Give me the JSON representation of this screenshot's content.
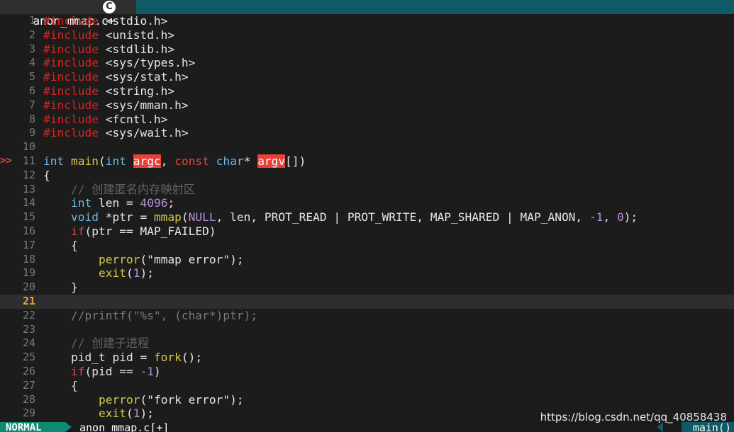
{
  "tabline": {
    "tab_title": "anon_mmap.c+",
    "lang_icon": "C"
  },
  "editor": {
    "sign_marker": ">>",
    "current_line": 21,
    "lines": [
      {
        "n": "1",
        "segs": [
          [
            "inc",
            "#include"
          ],
          [
            "txt",
            " <stdio.h>"
          ]
        ]
      },
      {
        "n": "2",
        "segs": [
          [
            "inc",
            "#include"
          ],
          [
            "txt",
            " <unistd.h>"
          ]
        ]
      },
      {
        "n": "3",
        "segs": [
          [
            "inc",
            "#include"
          ],
          [
            "txt",
            " <stdlib.h>"
          ]
        ]
      },
      {
        "n": "4",
        "segs": [
          [
            "inc",
            "#include"
          ],
          [
            "txt",
            " <sys/types.h>"
          ]
        ]
      },
      {
        "n": "5",
        "segs": [
          [
            "inc",
            "#include"
          ],
          [
            "txt",
            " <sys/stat.h>"
          ]
        ]
      },
      {
        "n": "6",
        "segs": [
          [
            "inc",
            "#include"
          ],
          [
            "txt",
            " <string.h>"
          ]
        ]
      },
      {
        "n": "7",
        "segs": [
          [
            "inc",
            "#include"
          ],
          [
            "txt",
            " <sys/mman.h>"
          ]
        ]
      },
      {
        "n": "8",
        "segs": [
          [
            "inc",
            "#include"
          ],
          [
            "txt",
            " <fcntl.h>"
          ]
        ]
      },
      {
        "n": "9",
        "segs": [
          [
            "inc",
            "#include"
          ],
          [
            "txt",
            " <sys/wait.h>"
          ]
        ]
      },
      {
        "n": "10",
        "segs": []
      },
      {
        "n": "11",
        "sign": true,
        "segs": [
          [
            "type",
            "int"
          ],
          [
            "txt",
            " "
          ],
          [
            "fn",
            "main"
          ],
          [
            "txt",
            "("
          ],
          [
            "type",
            "int"
          ],
          [
            "txt",
            " "
          ],
          [
            "hl",
            "argc"
          ],
          [
            "txt",
            ", "
          ],
          [
            "kw",
            "const"
          ],
          [
            "txt",
            " "
          ],
          [
            "type",
            "char"
          ],
          [
            "txt",
            "* "
          ],
          [
            "hl",
            "argv"
          ],
          [
            "txt",
            "[])"
          ]
        ]
      },
      {
        "n": "12",
        "segs": [
          [
            "txt",
            "{"
          ]
        ]
      },
      {
        "n": "13",
        "segs": [
          [
            "txt",
            "    "
          ],
          [
            "cmt",
            "// 创建匿名内存映射区"
          ]
        ]
      },
      {
        "n": "14",
        "segs": [
          [
            "txt",
            "    "
          ],
          [
            "type",
            "int"
          ],
          [
            "txt",
            " len = "
          ],
          [
            "num",
            "4096"
          ],
          [
            "txt",
            ";"
          ]
        ]
      },
      {
        "n": "15",
        "segs": [
          [
            "txt",
            "    "
          ],
          [
            "type",
            "void"
          ],
          [
            "txt",
            " *ptr = "
          ],
          [
            "fn",
            "mmap"
          ],
          [
            "txt",
            "("
          ],
          [
            "nul",
            "NULL"
          ],
          [
            "txt",
            ", len, PROT_READ | PROT_WRITE, MAP_SHARED | MAP_ANON, "
          ],
          [
            "num",
            "-1"
          ],
          [
            "txt",
            ", "
          ],
          [
            "num",
            "0"
          ],
          [
            "txt",
            ");"
          ]
        ]
      },
      {
        "n": "16",
        "segs": [
          [
            "txt",
            "    "
          ],
          [
            "kw",
            "if"
          ],
          [
            "txt",
            "(ptr == MAP_FAILED)"
          ]
        ]
      },
      {
        "n": "17",
        "segs": [
          [
            "txt",
            "    {"
          ]
        ]
      },
      {
        "n": "18",
        "segs": [
          [
            "txt",
            "        "
          ],
          [
            "fn",
            "perror"
          ],
          [
            "txt",
            "("
          ],
          [
            "str",
            "\"mmap error\""
          ],
          [
            "txt",
            ");"
          ]
        ]
      },
      {
        "n": "19",
        "segs": [
          [
            "txt",
            "        "
          ],
          [
            "fn",
            "exit"
          ],
          [
            "txt",
            "("
          ],
          [
            "num",
            "1"
          ],
          [
            "txt",
            ");"
          ]
        ]
      },
      {
        "n": "20",
        "segs": [
          [
            "txt",
            "    }"
          ]
        ]
      },
      {
        "n": "21",
        "segs": []
      },
      {
        "n": "22",
        "segs": [
          [
            "txt",
            "    "
          ],
          [
            "cmt2",
            "//printf(\"%s\", (char*)ptr);"
          ]
        ]
      },
      {
        "n": "23",
        "segs": []
      },
      {
        "n": "24",
        "segs": [
          [
            "txt",
            "    "
          ],
          [
            "cmt",
            "// 创建子进程"
          ]
        ]
      },
      {
        "n": "25",
        "segs": [
          [
            "txt",
            "    pid_t pid = "
          ],
          [
            "fn",
            "fork"
          ],
          [
            "txt",
            "();"
          ]
        ]
      },
      {
        "n": "26",
        "segs": [
          [
            "txt",
            "    "
          ],
          [
            "kw",
            "if"
          ],
          [
            "txt",
            "(pid == "
          ],
          [
            "num",
            "-1"
          ],
          [
            "txt",
            ")"
          ]
        ]
      },
      {
        "n": "27",
        "segs": [
          [
            "txt",
            "    {"
          ]
        ]
      },
      {
        "n": "28",
        "segs": [
          [
            "txt",
            "        "
          ],
          [
            "fn",
            "perror"
          ],
          [
            "txt",
            "("
          ],
          [
            "str",
            "\"fork error\""
          ],
          [
            "txt",
            ");"
          ]
        ]
      },
      {
        "n": "29",
        "segs": [
          [
            "txt",
            "        "
          ],
          [
            "fn",
            "exit"
          ],
          [
            "txt",
            "("
          ],
          [
            "num",
            "1"
          ],
          [
            "txt",
            ");"
          ]
        ]
      }
    ]
  },
  "statusline": {
    "mode": "NORMAL",
    "filename": "anon_mmap.c[+]",
    "function": "main()"
  },
  "watermark": "https://blog.csdn.net/qq_40858438",
  "colors": {
    "tabline_bg": "#0e5a66",
    "mode_bg": "#0e8a73",
    "include": "#d9231c",
    "type": "#71b9e8",
    "keyword": "#e04545",
    "function": "#d7c84b",
    "number": "#b98ed8",
    "highlight": "#e8403a",
    "current_line_number": "#e8a236"
  }
}
